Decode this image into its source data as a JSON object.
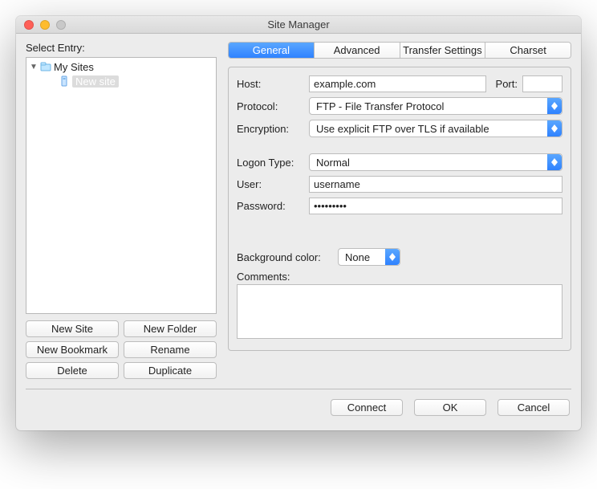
{
  "window": {
    "title": "Site Manager"
  },
  "left": {
    "label": "Select Entry:",
    "root": "My Sites",
    "selected": "New site",
    "buttons": {
      "new_site": "New Site",
      "new_folder": "New Folder",
      "new_bookmark": "New Bookmark",
      "rename": "Rename",
      "delete": "Delete",
      "duplicate": "Duplicate"
    }
  },
  "tabs": {
    "general": "General",
    "advanced": "Advanced",
    "transfer": "Transfer Settings",
    "charset": "Charset"
  },
  "form": {
    "host_label": "Host:",
    "host_value": "example.com",
    "port_label": "Port:",
    "port_value": "",
    "protocol_label": "Protocol:",
    "protocol_value": "FTP - File Transfer Protocol",
    "encryption_label": "Encryption:",
    "encryption_value": "Use explicit FTP over TLS if available",
    "logon_label": "Logon Type:",
    "logon_value": "Normal",
    "user_label": "User:",
    "user_value": "username",
    "pass_label": "Password:",
    "pass_value": "•••••••••",
    "bgcolor_label": "Background color:",
    "bgcolor_value": "None",
    "comments_label": "Comments:",
    "comments_value": ""
  },
  "footer": {
    "connect": "Connect",
    "ok": "OK",
    "cancel": "Cancel"
  }
}
